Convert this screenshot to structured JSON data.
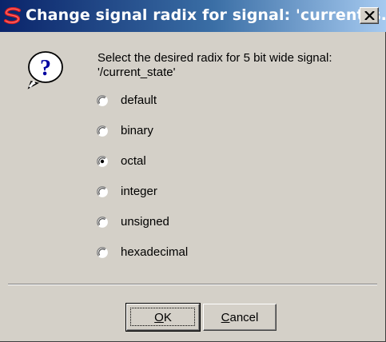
{
  "window": {
    "title": "Change signal radix for signal: 'current_s...",
    "close_symbol": "✕",
    "app_icon": "app-logo-icon",
    "titlebar_color": "#0a246a"
  },
  "message": {
    "line1": "Select the desired radix for 5 bit wide signal:",
    "line2": "'/current_state'",
    "icon": "question-icon"
  },
  "radix_options": [
    {
      "label": "default",
      "selected": false
    },
    {
      "label": "binary",
      "selected": false
    },
    {
      "label": "octal",
      "selected": true
    },
    {
      "label": "integer",
      "selected": false
    },
    {
      "label": "unsigned",
      "selected": false
    },
    {
      "label": "hexadecimal",
      "selected": false
    }
  ],
  "buttons": {
    "ok_first": "O",
    "ok_rest": "K",
    "cancel_first": "C",
    "cancel_rest": "ancel"
  }
}
